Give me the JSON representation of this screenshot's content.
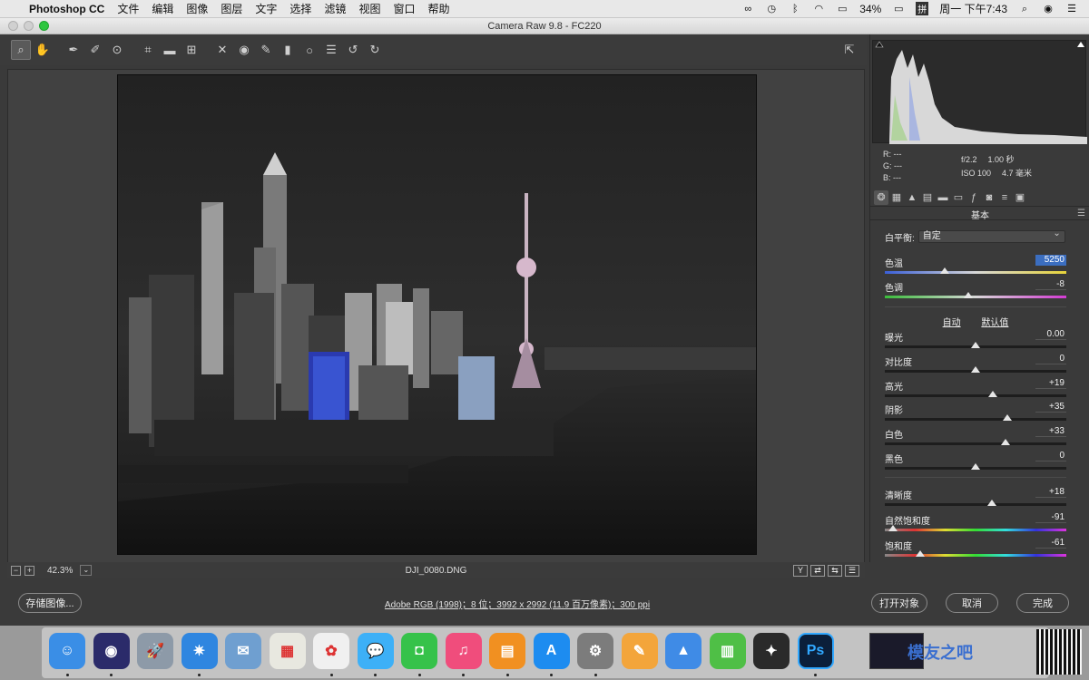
{
  "menubar": {
    "app_name": "Photoshop CC",
    "items": [
      "文件",
      "编辑",
      "图像",
      "图层",
      "文字",
      "选择",
      "滤镜",
      "视图",
      "窗口",
      "帮助"
    ],
    "battery": "34%",
    "input_method": "拼",
    "clock": "周一 下午7:43"
  },
  "window": {
    "title": "Camera Raw 9.8  -  FC220"
  },
  "toolbar": {
    "tools": [
      "zoom-tool",
      "hand-tool",
      "white-balance-tool",
      "color-sampler-tool",
      "targeted-adjustment-tool",
      "crop-tool",
      "straighten-tool",
      "transform-tool",
      "spot-removal-tool",
      "red-eye-tool",
      "adjustment-brush-tool",
      "graduated-filter-tool",
      "radial-filter-tool",
      "preferences-tool",
      "rotate-left-tool",
      "rotate-right-tool"
    ],
    "active_tool": "zoom-tool"
  },
  "statusbar": {
    "zoom": "42.3%",
    "filename": "DJI_0080.DNG",
    "view_buttons": [
      "Y",
      "⇄",
      "⇆",
      "☰"
    ]
  },
  "readout": {
    "r_label": "R:",
    "g_label": "G:",
    "b_label": "B:",
    "r_value": "---",
    "g_value": "---",
    "b_value": "---",
    "aperture": "f/2.2",
    "shutter": "1.00 秒",
    "iso": "ISO 100",
    "focal": "4.7 毫米"
  },
  "panel": {
    "title": "基本",
    "wb_label": "白平衡:",
    "wb_value": "自定",
    "auto_label": "自动",
    "default_label": "默认值",
    "sliders": [
      {
        "label": "色温",
        "value": "5250",
        "level": 0.33,
        "track": "temp",
        "selected": true
      },
      {
        "label": "色调",
        "value": "-8",
        "level": 0.46,
        "track": "tint",
        "selected": false
      },
      {
        "label": "曝光",
        "value": "0.00",
        "level": 0.5,
        "track": "plain",
        "selected": false
      },
      {
        "label": "对比度",
        "value": "0",
        "level": 0.5,
        "track": "plain",
        "selected": false
      },
      {
        "label": "高光",
        "value": "+19",
        "level": 0.595,
        "track": "plain",
        "selected": false
      },
      {
        "label": "阴影",
        "value": "+35",
        "level": 0.675,
        "track": "plain",
        "selected": false
      },
      {
        "label": "白色",
        "value": "+33",
        "level": 0.665,
        "track": "plain",
        "selected": false
      },
      {
        "label": "黑色",
        "value": "0",
        "level": 0.5,
        "track": "plain",
        "selected": false
      },
      {
        "label": "清晰度",
        "value": "+18",
        "level": 0.59,
        "track": "plain",
        "selected": false
      },
      {
        "label": "自然饱和度",
        "value": "-91",
        "level": 0.045,
        "track": "rainbow",
        "selected": false
      },
      {
        "label": "饱和度",
        "value": "-61",
        "level": 0.195,
        "track": "rainbow",
        "selected": false
      }
    ]
  },
  "footer": {
    "save_label": "存储图像...",
    "workflow_link": "Adobe RGB (1998)；8 位；3992 x 2992 (11.9 百万像素)；300 ppi",
    "open_label": "打开对象",
    "cancel_label": "取消",
    "done_label": "完成"
  },
  "dock": {
    "apps": [
      {
        "name": "finder",
        "color": "#3a8ee6",
        "glyph": "☺"
      },
      {
        "name": "siri",
        "color": "#2b2b6a",
        "glyph": "◉"
      },
      {
        "name": "launchpad",
        "color": "#8d9aa8",
        "glyph": "🚀"
      },
      {
        "name": "safari",
        "color": "#2f86e0",
        "glyph": "✷"
      },
      {
        "name": "preview",
        "color": "#6f9fd0",
        "glyph": "✉"
      },
      {
        "name": "calendar-photos",
        "color": "#e8e8e0",
        "glyph": "▦"
      },
      {
        "name": "photos",
        "color": "#f0f0f0",
        "glyph": "✿"
      },
      {
        "name": "messages",
        "color": "#3db0f7",
        "glyph": "💬"
      },
      {
        "name": "facetime",
        "color": "#36c24a",
        "glyph": "◘"
      },
      {
        "name": "itunes",
        "color": "#f04d7c",
        "glyph": "♫"
      },
      {
        "name": "ibooks",
        "color": "#f19021",
        "glyph": "▤"
      },
      {
        "name": "app-store",
        "color": "#1d8cf0",
        "glyph": "A"
      },
      {
        "name": "system-preferences",
        "color": "#7c7c7c",
        "glyph": "⚙"
      },
      {
        "name": "pages",
        "color": "#f3a53b",
        "glyph": "✎"
      },
      {
        "name": "keynote",
        "color": "#3f8be6",
        "glyph": "▲"
      },
      {
        "name": "numbers",
        "color": "#4fbf46",
        "glyph": "▥"
      },
      {
        "name": "final-cut",
        "color": "#2a2a2a",
        "glyph": "✦"
      },
      {
        "name": "photoshop",
        "color": "#0b1f3a",
        "glyph": "Ps"
      }
    ],
    "watermark": "模友之吧"
  }
}
